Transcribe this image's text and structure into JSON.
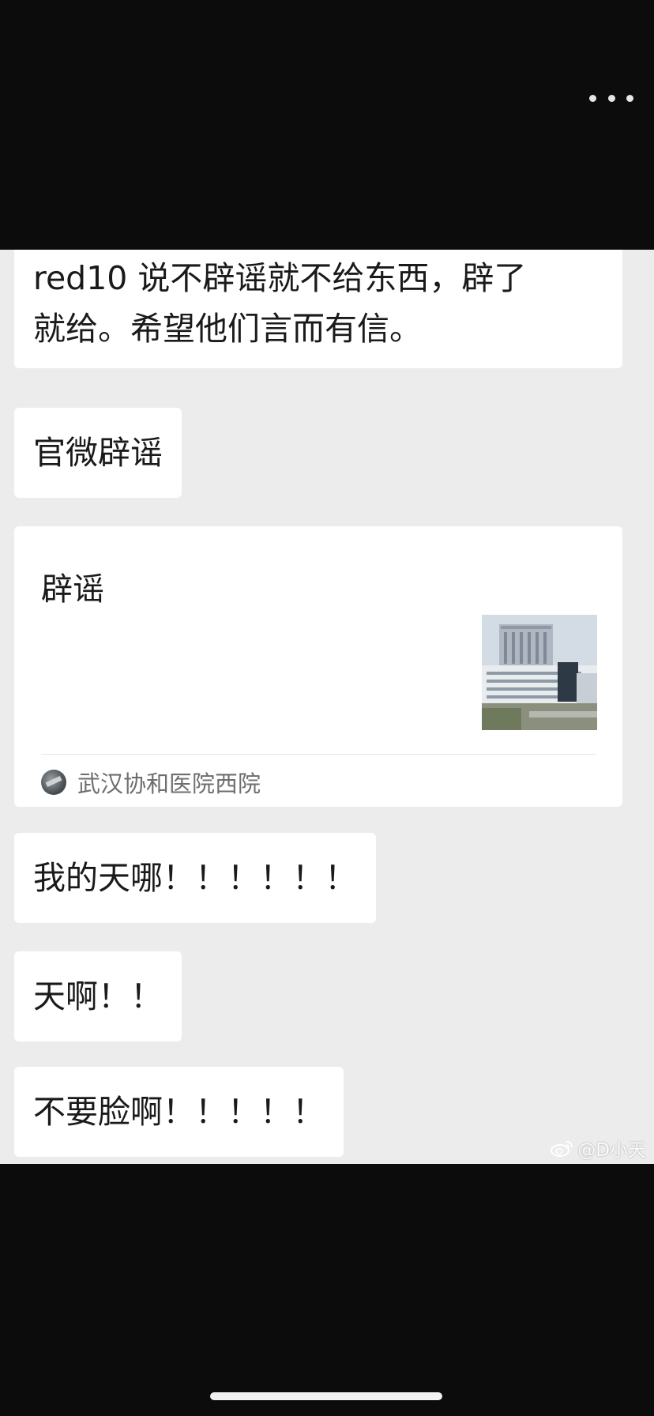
{
  "header": {
    "menu_icon": "more-dots-icon"
  },
  "messages": {
    "msg1": {
      "line1": "red10 说不辟谣就不给东西，辟了",
      "line2": "就给。希望他们言而有信。"
    },
    "msg2": "官微辟谣",
    "link_card": {
      "title": "辟谣",
      "thumbnail_icon": "hospital-building-thumbnail",
      "source_name": "武汉协和医院西院"
    },
    "msg4": "我的天哪！！！！！！",
    "msg5": "天啊！！",
    "msg6": "不要脸啊！！！！！"
  },
  "watermark": {
    "text": "@D小天",
    "logo_icon": "weibo-logo-icon"
  },
  "colors": {
    "chat_background": "#ececec",
    "bubble_background": "#ffffff",
    "outer_background": "#0c0c0c"
  }
}
